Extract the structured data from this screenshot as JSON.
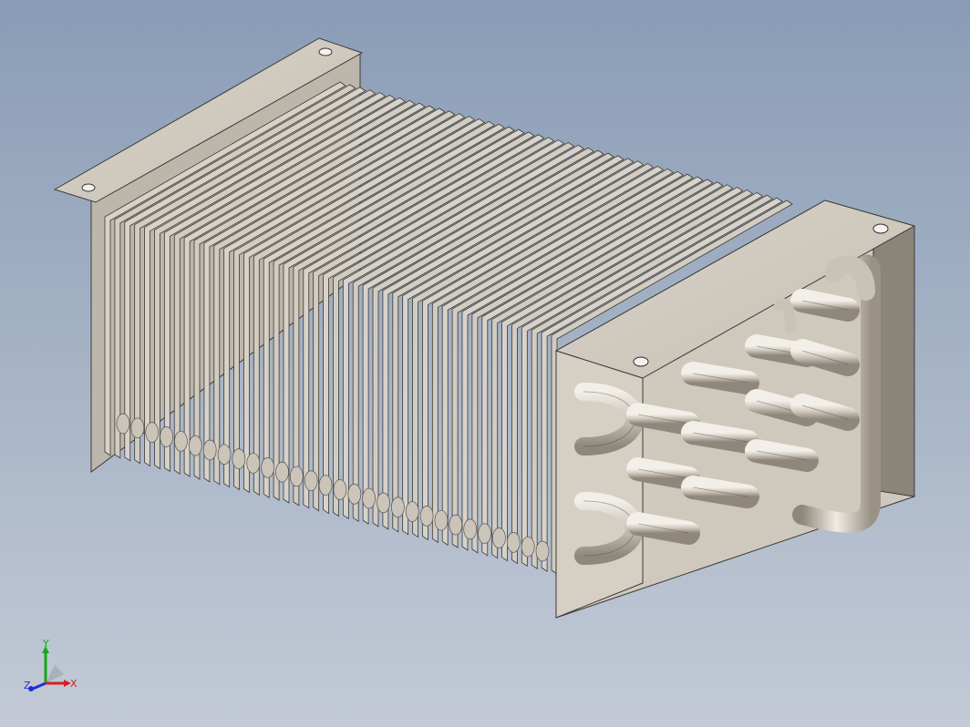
{
  "viewport": {
    "background_top": "#8a9cb6",
    "background_bottom": "#c3cad6"
  },
  "model": {
    "name": "",
    "fin_color": "#d8d2c8",
    "fin_edge_color": "#3a3a3a",
    "tube_color": "#cfc8bd",
    "bracket_color": "#d9d2c6"
  },
  "triad": {
    "x_label": "X",
    "y_label": "Y",
    "z_label": "Z",
    "x_color": "#d42020",
    "y_color": "#1aa51a",
    "z_color": "#2030d0"
  }
}
